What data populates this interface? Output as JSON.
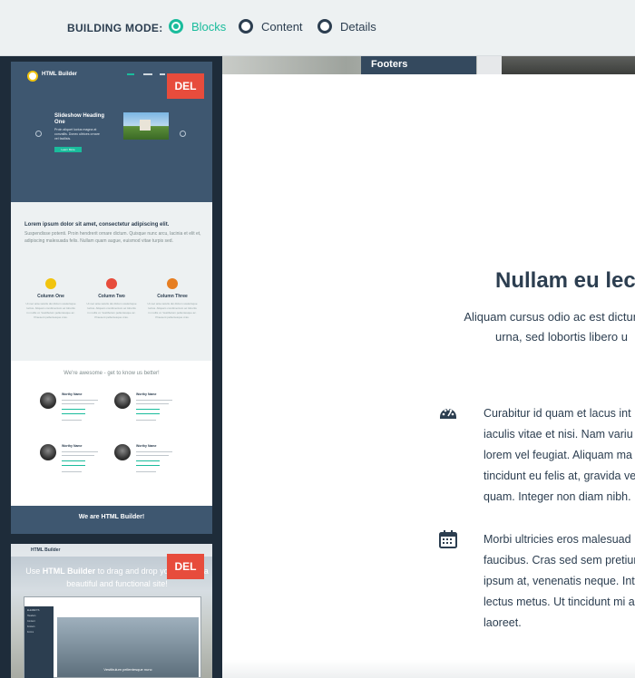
{
  "topbar": {
    "mode_label": "BUILDING MODE:",
    "modes": [
      {
        "label": "Blocks",
        "active": true
      },
      {
        "label": "Content",
        "active": false
      },
      {
        "label": "Details",
        "active": false
      }
    ]
  },
  "sidebar": {
    "del_label": "DEL",
    "thumb1": {
      "brand": "HTML Builder",
      "slide_title": "Slideshow Heading One",
      "slide_text": "Proin aliquet luctus magna at convallis. Donec ultrices ornare vel facilisis.",
      "slide_button": "Learn More",
      "body_title": "Lorem ipsum dolor sit amet, consectetur adipiscing elit.",
      "body_text": "Suspendisse potenti. Proin hendrerit ornare dictum. Quisque nunc arcu, lacinia et elit et, adipiscing malesuada felis. Nullam quam augue, euismod vitae turpis sed.",
      "columns": [
        {
          "title": "Column One",
          "text": "Ut nec ante iaculis dui dictum scelerisque luctus. Aliquam condimentum ac lobortis in mollis ut. Vestibulum pellentesque ac. Praesent pellentesque cras."
        },
        {
          "title": "Column Two",
          "text": "Ut nec ante iaculis dui dictum scelerisque luctus. Aliquam condimentum ac lobortis in mollis ut. Vestibulum pellentesque ac. Praesent pellentesque cras."
        },
        {
          "title": "Column Three",
          "text": "Ut nec ante iaculis dui dictum scelerisque luctus. Aliquam condimentum ac lobortis in mollis ut. Vestibulum pellentesque ac. Praesent pellentesque cras."
        }
      ],
      "team_title": "We're awesome - get to know us better!",
      "person_name": "Worthy Name",
      "footer_text": "We are HTML Builder!"
    },
    "thumb2": {
      "brand": "HTML Builder",
      "headline_pre": "Use ",
      "headline_bold": "HTML Builder",
      "headline_post": " to drag and drop your way to a beautiful and functional site!",
      "screen_items": [
        "ELEMENTS",
        "Headers",
        "Content",
        "Footers",
        "Forms"
      ],
      "screen_hero": "Vestibulum pellentesque nunc"
    }
  },
  "main": {
    "footers_tab": "Footers",
    "heading": "Nullam eu lect",
    "subtext_lines": [
      "Aliquam cursus odio ac est dictum po",
      "urna, sed lobortis libero u"
    ],
    "feature1_lines": [
      "Curabitur id quam et lacus int",
      "iaculis vitae et nisi. Nam variu",
      "lorem vel feugiat. Aliquam ma",
      "tincidunt eu felis at, gravida ve",
      "quam. Integer non diam nibh."
    ],
    "feature2_lines": [
      "Morbi ultricies eros malesuad",
      "faucibus. Cras sed sem pretiur",
      "ipsum at, venenatis neque. Int",
      "lectus metus. Ut tincidunt mi a",
      "laoreet."
    ],
    "feature1_icon": "dashboard-icon",
    "feature2_icon": "calendar-icon",
    "accent": "#1abc9c",
    "text_color": "#2c3e50"
  }
}
